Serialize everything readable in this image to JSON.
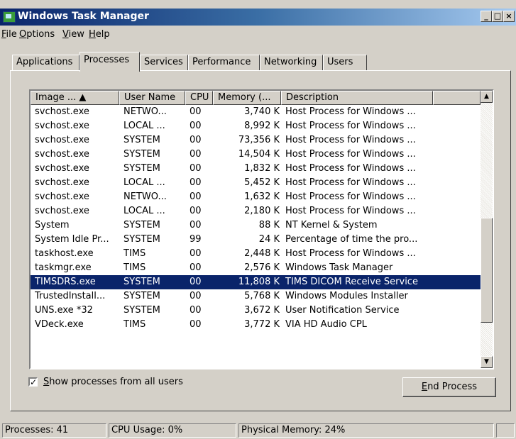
{
  "window": {
    "title": "Windows Task Manager",
    "minimize_glyph": "_",
    "maximize_glyph": "□",
    "close_glyph": "×"
  },
  "menu": {
    "file_key": "F",
    "file_rest": "ile",
    "options_key": "O",
    "options_rest": "ptions",
    "view_key": "V",
    "view_rest": "iew",
    "help_key": "H",
    "help_rest": "elp"
  },
  "tabs": [
    {
      "label": "Applications"
    },
    {
      "label": "Processes"
    },
    {
      "label": "Services"
    },
    {
      "label": "Performance"
    },
    {
      "label": "Networking"
    },
    {
      "label": "Users"
    }
  ],
  "table": {
    "headers": {
      "image": "Image ...  ▲",
      "user": "User Name",
      "cpu": "CPU",
      "memory": "Memory (...",
      "description": "Description"
    },
    "rows": [
      {
        "image": "svchost.exe",
        "user": "NETWO...",
        "cpu": "00",
        "memory": "3,740 K",
        "description": "Host Process for Windows ..."
      },
      {
        "image": "svchost.exe",
        "user": "LOCAL ...",
        "cpu": "00",
        "memory": "8,992 K",
        "description": "Host Process for Windows ..."
      },
      {
        "image": "svchost.exe",
        "user": "SYSTEM",
        "cpu": "00",
        "memory": "73,356 K",
        "description": "Host Process for Windows ..."
      },
      {
        "image": "svchost.exe",
        "user": "SYSTEM",
        "cpu": "00",
        "memory": "14,504 K",
        "description": "Host Process for Windows ..."
      },
      {
        "image": "svchost.exe",
        "user": "SYSTEM",
        "cpu": "00",
        "memory": "1,832 K",
        "description": "Host Process for Windows ..."
      },
      {
        "image": "svchost.exe",
        "user": "LOCAL ...",
        "cpu": "00",
        "memory": "5,452 K",
        "description": "Host Process for Windows ..."
      },
      {
        "image": "svchost.exe",
        "user": "NETWO...",
        "cpu": "00",
        "memory": "1,632 K",
        "description": "Host Process for Windows ..."
      },
      {
        "image": "svchost.exe",
        "user": "LOCAL ...",
        "cpu": "00",
        "memory": "2,180 K",
        "description": "Host Process for Windows ..."
      },
      {
        "image": "System",
        "user": "SYSTEM",
        "cpu": "00",
        "memory": "88 K",
        "description": "NT Kernel & System"
      },
      {
        "image": "System Idle Pr...",
        "user": "SYSTEM",
        "cpu": "99",
        "memory": "24 K",
        "description": "Percentage of time the pro..."
      },
      {
        "image": "taskhost.exe",
        "user": "TIMS",
        "cpu": "00",
        "memory": "2,448 K",
        "description": "Host Process for Windows ..."
      },
      {
        "image": "taskmgr.exe",
        "user": "TIMS",
        "cpu": "00",
        "memory": "2,576 K",
        "description": "Windows Task Manager"
      },
      {
        "image": "TIMSDRS.exe",
        "user": "SYSTEM",
        "cpu": "00",
        "memory": "11,808 K",
        "description": "TIMS DICOM Receive Service",
        "selected": true
      },
      {
        "image": "TrustedInstall...",
        "user": "SYSTEM",
        "cpu": "00",
        "memory": "5,768 K",
        "description": "Windows Modules Installer"
      },
      {
        "image": "UNS.exe *32",
        "user": "SYSTEM",
        "cpu": "00",
        "memory": "3,672 K",
        "description": "User Notification Service"
      },
      {
        "image": "VDeck.exe",
        "user": "TIMS",
        "cpu": "00",
        "memory": "3,772 K",
        "description": "VIA HD Audio CPL"
      }
    ]
  },
  "show_all": {
    "checked": true,
    "check_glyph": "✓",
    "key": "S",
    "rest": "how processes from all users"
  },
  "end_process": {
    "key": "E",
    "rest": "nd Process"
  },
  "status": {
    "processes": "Processes: 41",
    "cpu": "CPU Usage: 0%",
    "memory": "Physical Memory: 24%"
  },
  "colors": {
    "face": "#d4d0c8",
    "selection": "#0a246a",
    "title_start": "#0a246a",
    "title_end": "#a6caf0"
  },
  "icons": {
    "app": "task-manager-icon",
    "sort": "sort-ascending-icon",
    "scroll_up": "arrow-up-icon",
    "scroll_down": "arrow-down-icon"
  }
}
